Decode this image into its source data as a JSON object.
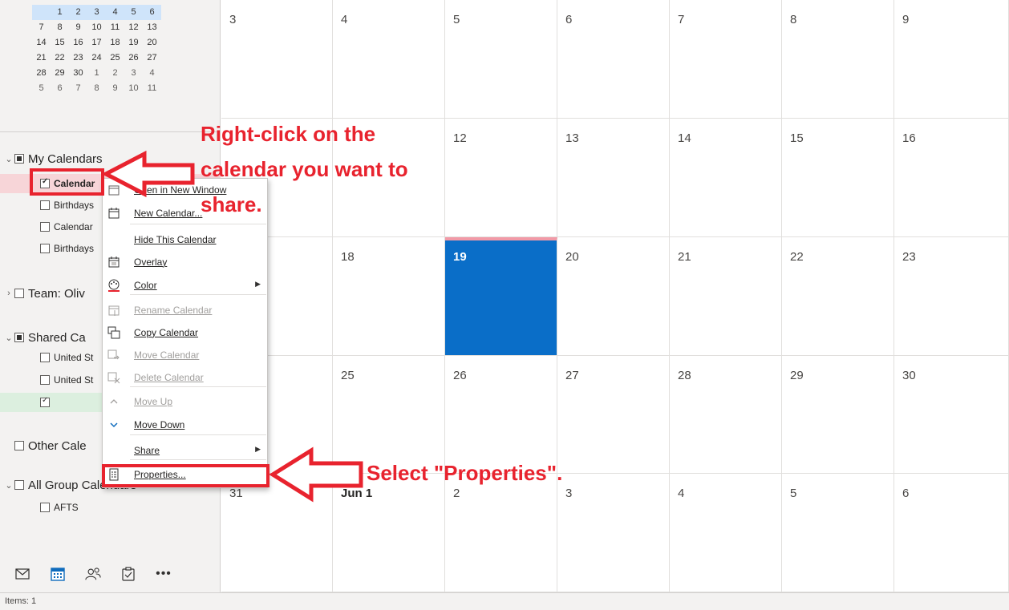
{
  "mini_calendar": {
    "rows": [
      [
        "",
        "1",
        "2",
        "3",
        "4",
        "5",
        "6"
      ],
      [
        "7",
        "8",
        "9",
        "10",
        "11",
        "12",
        "13"
      ],
      [
        "14",
        "15",
        "16",
        "17",
        "18",
        "19",
        "20"
      ],
      [
        "21",
        "22",
        "23",
        "24",
        "25",
        "26",
        "27"
      ],
      [
        "28",
        "29",
        "30",
        "1",
        "2",
        "3",
        "4"
      ],
      [
        "5",
        "6",
        "7",
        "8",
        "9",
        "10",
        "11"
      ]
    ]
  },
  "sidebar": {
    "my_calendars": {
      "label": "My Calendars",
      "items": [
        "Calendar",
        "Birthdays",
        "Calendar",
        "Birthdays"
      ]
    },
    "team": {
      "label": "Team: Oliv"
    },
    "shared": {
      "label": "Shared Ca",
      "items": [
        "United St",
        "United St",
        ""
      ]
    },
    "other": {
      "label": "Other Cale"
    },
    "all_group": {
      "label": "All Group Calendars",
      "items": [
        "AFTS"
      ]
    }
  },
  "nav_icons": [
    "mail-icon",
    "calendar-icon",
    "people-icon",
    "tasks-icon",
    "more-icon"
  ],
  "status_bar": {
    "text": "Items: 1"
  },
  "month_grid": {
    "rows": [
      [
        "3",
        "4",
        "5",
        "6",
        "7",
        "8",
        "9"
      ],
      [
        "",
        "",
        "12",
        "13",
        "14",
        "15",
        "16"
      ],
      [
        "",
        "18",
        "19",
        "20",
        "21",
        "22",
        "23"
      ],
      [
        "",
        "25",
        "26",
        "27",
        "28",
        "29",
        "30"
      ],
      [
        "31",
        "Jun 1",
        "2",
        "3",
        "4",
        "5",
        "6"
      ]
    ],
    "today": "19"
  },
  "context_menu": {
    "items": [
      {
        "label": "Open in New Window",
        "icon": "new-window-icon"
      },
      {
        "label": "New Calendar...",
        "icon": "new-calendar-icon"
      },
      {
        "label": "Hide This Calendar",
        "icon": ""
      },
      {
        "label": "Overlay",
        "icon": "overlay-icon"
      },
      {
        "label": "Color",
        "icon": "color-palette-icon",
        "submenu": true
      },
      {
        "label": "Rename Calendar",
        "icon": "rename-icon",
        "disabled": true
      },
      {
        "label": "Copy Calendar",
        "icon": "copy-calendar-icon"
      },
      {
        "label": "Move Calendar",
        "icon": "move-calendar-icon",
        "disabled": true
      },
      {
        "label": "Delete Calendar",
        "icon": "delete-calendar-icon",
        "disabled": true
      },
      {
        "label": "Move Up",
        "icon": "chevron-up-icon",
        "disabled": true
      },
      {
        "label": "Move Down",
        "icon": "chevron-down-icon"
      },
      {
        "label": "Share",
        "icon": "",
        "submenu": true
      },
      {
        "label": "Properties...",
        "icon": "properties-icon"
      }
    ]
  },
  "annotations": {
    "right_click": [
      "Right-click on the",
      "calendar you want to",
      "share."
    ],
    "select_properties": "Select \"Properties\"."
  },
  "colors": {
    "annotation": "#e8232e",
    "today": "#0a6ec8",
    "today_bar": "#f29aa7",
    "selected_pink": "#f7d5d8"
  }
}
